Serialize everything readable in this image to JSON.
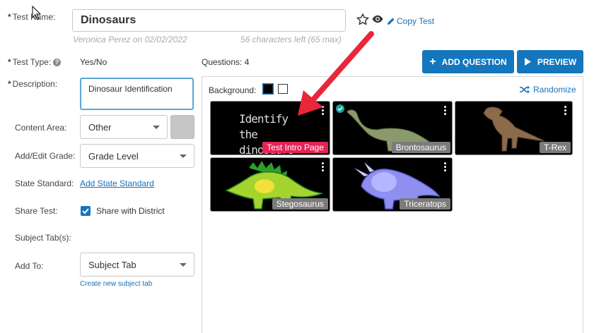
{
  "form": {
    "test_name_label": "Test Name:",
    "test_name_value": "Dinosaurs",
    "author_line": "Veronica Perez on 02/02/2022",
    "chars_left": "56 characters left (65 max)",
    "copy_test": "Copy Test",
    "test_type_label": "Test Type:",
    "test_type_value": "Yes/No",
    "description_label": "Description:",
    "description_value": "Dinosaur Identification",
    "content_area_label": "Content Area:",
    "content_area_value": "Other",
    "grade_label": "Add/Edit Grade:",
    "grade_value": "Grade Level",
    "standard_label": "State Standard:",
    "standard_link": "Add State Standard",
    "share_label": "Share Test:",
    "share_value": "Share with District",
    "subject_tabs_label": "Subject Tab(s):",
    "add_to_label": "Add To:",
    "add_to_value": "Subject Tab",
    "create_tab_link": "Create new subject tab"
  },
  "questions": {
    "count_label": "Questions: 4",
    "add_button": "ADD QUESTION",
    "preview_button": "PREVIEW",
    "background_label": "Background:",
    "randomize": "Randomize",
    "items": [
      {
        "label": "Test Intro Page",
        "image_text": "Identify the dinosaurs"
      },
      {
        "label": "Brontosaurus"
      },
      {
        "label": "T-Rex"
      },
      {
        "label": "Stegosaurus"
      },
      {
        "label": "Triceratops"
      }
    ]
  },
  "colors": {
    "accent": "#1476bd",
    "intro_label": "#e52354",
    "arrow": "#e8273a"
  }
}
